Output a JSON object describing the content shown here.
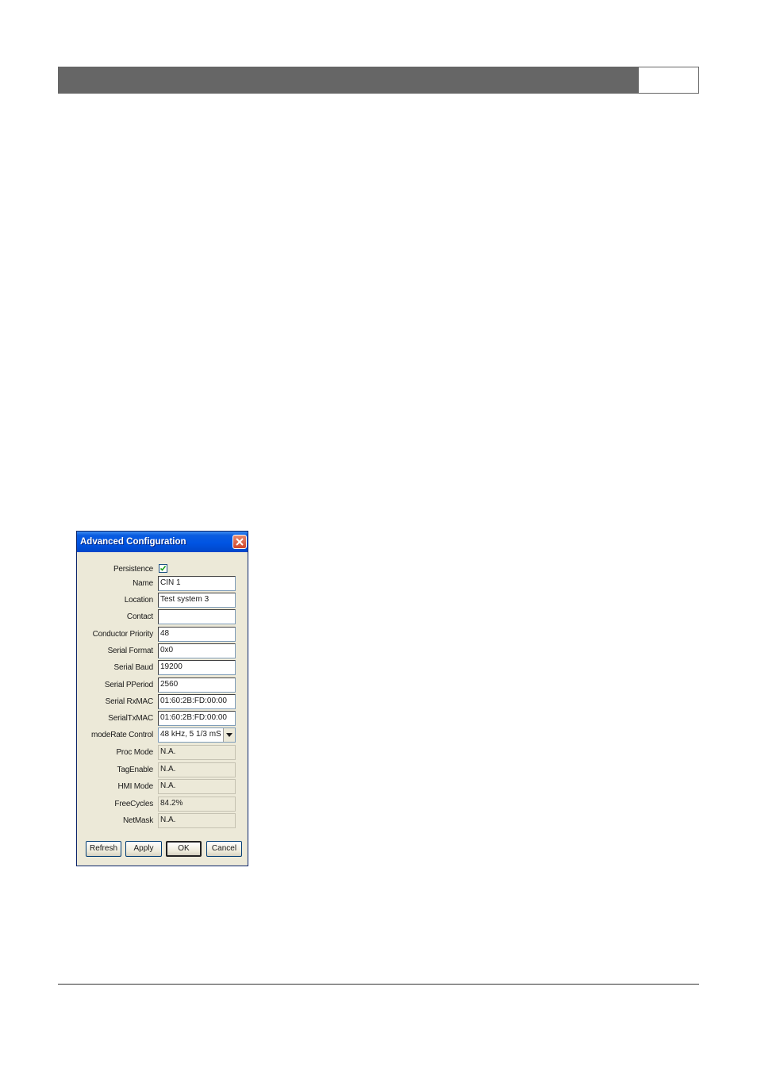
{
  "dialog": {
    "title": "Advanced Configuration",
    "close_icon": "close-icon",
    "persistence": {
      "label": "Persistence",
      "checked": true
    },
    "fields": [
      {
        "key": "name",
        "label": "Name",
        "value": "CIN 1",
        "readonly": false
      },
      {
        "key": "location",
        "label": "Location",
        "value": "Test system 3",
        "readonly": false
      },
      {
        "key": "contact",
        "label": "Contact",
        "value": "",
        "readonly": false
      },
      {
        "key": "conductor-priority",
        "label": "Conductor Priority",
        "value": "48",
        "readonly": false
      },
      {
        "key": "serial-format",
        "label": "Serial Format",
        "value": "0x0",
        "readonly": false
      },
      {
        "key": "serial-baud",
        "label": "Serial Baud",
        "value": "19200",
        "readonly": false
      },
      {
        "key": "serial-pperiod",
        "label": "Serial PPeriod",
        "value": "2560",
        "readonly": false
      },
      {
        "key": "serial-rxmac",
        "label": "Serial RxMAC",
        "value": "01:60:2B:FD:00:00",
        "readonly": false
      },
      {
        "key": "serial-txmac",
        "label": "SerialTxMAC",
        "value": "01:60:2B:FD:00:00",
        "readonly": false
      }
    ],
    "moderate_control": {
      "label": "modeRate Control",
      "selected": "48 kHz, 5 1/3 mS"
    },
    "readonly_fields": [
      {
        "key": "proc-mode",
        "label": "Proc Mode",
        "value": "N.A."
      },
      {
        "key": "tag-enable",
        "label": "TagEnable",
        "value": "N.A."
      },
      {
        "key": "hmi-mode",
        "label": "HMI Mode",
        "value": "N.A."
      },
      {
        "key": "free-cycles",
        "label": "FreeCycles",
        "value": "84.2%"
      },
      {
        "key": "netmask",
        "label": "NetMask",
        "value": "N.A."
      }
    ],
    "buttons": {
      "refresh": "Refresh",
      "apply": "Apply",
      "ok": "OK",
      "cancel": "Cancel"
    }
  }
}
